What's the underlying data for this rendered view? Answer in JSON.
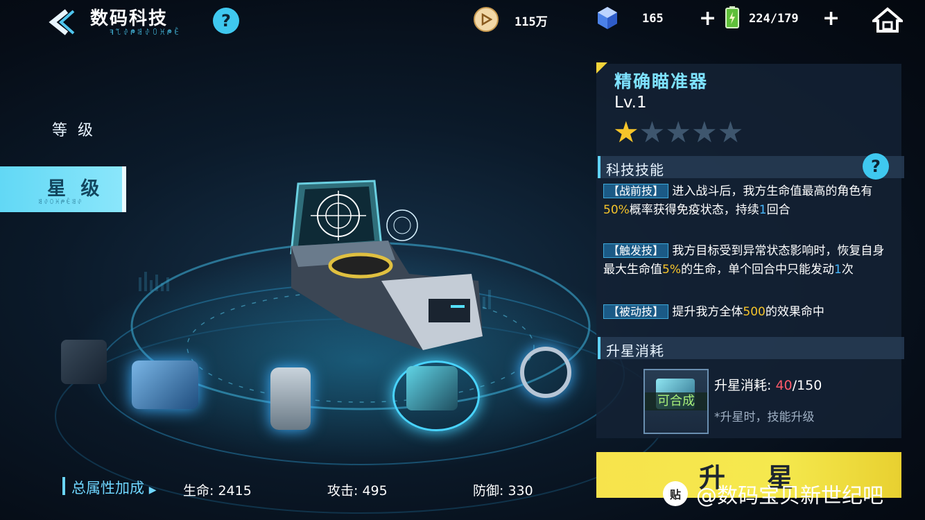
{
  "header": {
    "title": "数码科技",
    "subtitle": "ꟻ꒹ꂑᖘꌃꂑꄲꁝᖘꍟ",
    "help": "?",
    "coins": "115万",
    "gems": "165",
    "energy": "224/179",
    "plus": "+"
  },
  "left_nav": {
    "level_tab": "等 级",
    "star_tab": "星 级",
    "star_tab_sub": "ꌃꂑꄲꁝᖘꍟꌃꂑ"
  },
  "item": {
    "name": "精确瞄准器",
    "level": "Lv.1",
    "stars_filled": 1,
    "stars_total": 5
  },
  "skills": {
    "section_title": "科技技能",
    "help": "?",
    "list": [
      {
        "tag": "【战前技】",
        "parts": [
          {
            "t": "进入战斗后，我方生命值最高的角色有",
            "c": ""
          },
          {
            "t": "50%",
            "c": "y"
          },
          {
            "t": "概率获得免疫状态，持续",
            "c": ""
          },
          {
            "t": "1",
            "c": "b"
          },
          {
            "t": "回合",
            "c": ""
          }
        ]
      },
      {
        "tag": "【触发技】",
        "parts": [
          {
            "t": "我方目标受到异常状态影响时，恢复自身最大生命值",
            "c": ""
          },
          {
            "t": "5%",
            "c": "y"
          },
          {
            "t": "的生命，单个回合中只能发动",
            "c": ""
          },
          {
            "t": "1",
            "c": "b"
          },
          {
            "t": "次",
            "c": ""
          }
        ]
      },
      {
        "tag": "【被动技】",
        "parts": [
          {
            "t": "提升我方全体",
            "c": ""
          },
          {
            "t": "500",
            "c": "y"
          },
          {
            "t": "的效果命中",
            "c": ""
          }
        ]
      }
    ]
  },
  "cost": {
    "section_title": "升星消耗",
    "badge": "可合成",
    "label": "升星消耗:",
    "current": "40",
    "total": "/150",
    "note": "*升星时，技能升级"
  },
  "upgrade_button": "升星",
  "totals": {
    "title": "总属性加成",
    "hp": "生命: 2415",
    "atk": "攻击: 495",
    "def": "防御: 330"
  },
  "watermark": "@数码宝贝新世纪吧",
  "colors": {
    "accent": "#5fd4f5",
    "highlight_yellow": "#f5c42a",
    "highlight_blue": "#48b8ff",
    "star_filled": "#f5c42a",
    "button": "#f5e34c"
  }
}
